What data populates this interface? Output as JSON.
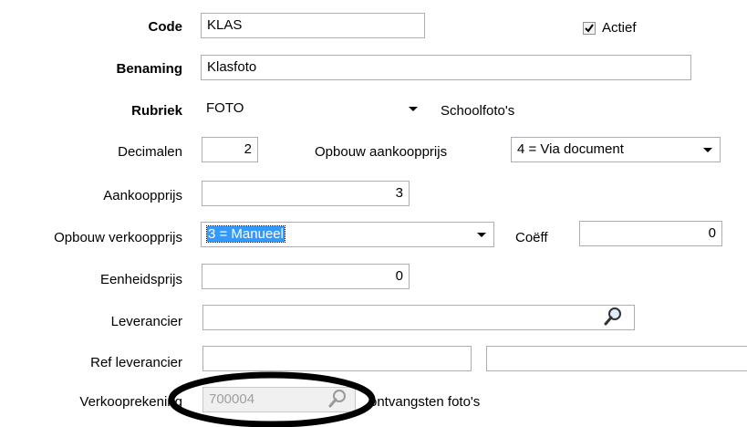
{
  "code": {
    "label": "Code",
    "value": "KLAS"
  },
  "actief": {
    "label": "Actief",
    "checked": true
  },
  "benaming": {
    "label": "Benaming",
    "value": "Klasfoto"
  },
  "rubriek": {
    "label": "Rubriek",
    "value": "FOTO",
    "description": "Schoolfoto's"
  },
  "decimalen": {
    "label": "Decimalen",
    "value": "2"
  },
  "opbouw_aankoopprijs": {
    "label": "Opbouw aankoopprijs",
    "value": "4 = Via document"
  },
  "aankoopprijs": {
    "label": "Aankoopprijs",
    "value": "3"
  },
  "opbouw_verkoopprijs": {
    "label": "Opbouw verkoopprijs",
    "value": "3 = Manueel"
  },
  "coeff": {
    "label": "Coëff",
    "value": "0"
  },
  "eenheidsprijs": {
    "label": "Eenheidsprijs",
    "value": "0"
  },
  "leverancier": {
    "label": "Leverancier",
    "value": ""
  },
  "ref_leverancier": {
    "label": "Ref leverancier",
    "value": "",
    "value2": ""
  },
  "verkooprekening": {
    "label": "Verkooprekening",
    "value": "700004",
    "description": "ontvangsten foto's"
  },
  "colors": {
    "highlight": "#3399ff",
    "border": "#abadb3",
    "disabled_bg": "#f0f0f0",
    "annotation": "#000000"
  },
  "icons": {
    "lookup": "magnifier-icon",
    "dropdown": "chevron-down-icon",
    "checkbox": "checkmark-icon"
  }
}
